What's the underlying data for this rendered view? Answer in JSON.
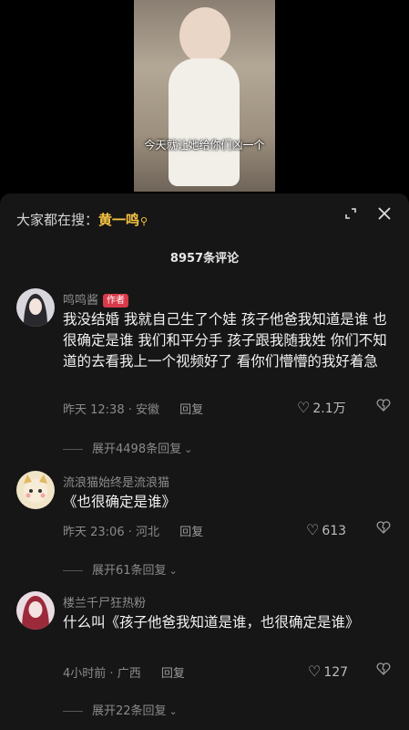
{
  "video": {
    "caption": "今天就让她给你们凶一个"
  },
  "header": {
    "search_prefix": "大家都在搜：",
    "search_term": "黄一鸣",
    "search_icon": "search-icon",
    "expand_icon": "expand-icon",
    "close_icon": "close-icon"
  },
  "comment_count": "8957条评论",
  "comments": [
    {
      "user": "鸣鸣酱",
      "badge": "作者",
      "text": "我没结婚 我就自己生了个娃 孩子他爸我知道是谁 也很确定是谁 我们和平分手 孩子跟我随我姓 你们不知道的去看我上一个视频好了 看你们懵懵的我好着急",
      "time": "昨天 12:38",
      "location": "安徽",
      "reply_label": "回复",
      "likes": "2.1万",
      "expand": "展开4498条回复"
    },
    {
      "user": "流浪猫始终是流浪猫",
      "text": "《也很确定是谁》",
      "time": "昨天 23:06",
      "location": "河北",
      "reply_label": "回复",
      "likes": "613",
      "expand": "展开61条回复"
    },
    {
      "user": "楼兰千尸狂热粉",
      "text": "什么叫《孩子他爸我知道是谁，也很确定是谁》",
      "time": "4小时前",
      "location": "广西",
      "reply_label": "回复",
      "likes": "127",
      "expand": "展开22条回复"
    }
  ],
  "colors": {
    "accent": "#f6c343",
    "badge": "#d93a4a",
    "sheet_bg": "#161616"
  }
}
